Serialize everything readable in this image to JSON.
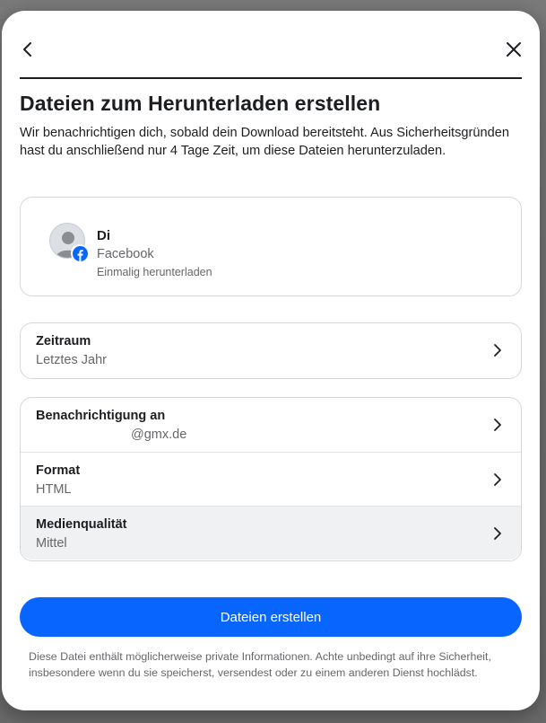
{
  "dialog": {
    "title": "Dateien zum Herunterladen erstellen",
    "description": "Wir benachrichtigen dich, sobald dein Download bereitsteht. Aus Sicherheitsgründen hast du anschließend nur 4 Tage Zeit, um diese Dateien herunterzuladen."
  },
  "account": {
    "name": "Di",
    "platform": "Facebook",
    "note": "Einmalig herunterladen",
    "avatar_icon": "user-silhouette-icon",
    "badge_icon": "facebook-icon"
  },
  "range": {
    "label": "Zeitraum",
    "value": "Letztes Jahr"
  },
  "settings": [
    {
      "label": "Benachrichtigung an",
      "value": "@gmx.de"
    },
    {
      "label": "Format",
      "value": "HTML"
    },
    {
      "label": "Medienqualität",
      "value": "Mittel"
    }
  ],
  "actions": {
    "create_label": "Dateien erstellen"
  },
  "footnote": "Diese Datei enthält möglicherweise private Informationen. Achte unbedingt auf ihre Sicherheit, insbesondere wenn du sie speicherst, versendest oder zu einem anderen Dienst hochlädst.",
  "colors": {
    "primary": "#0866ff",
    "text": "#1c1e21",
    "secondary_text": "#65676b",
    "border": "#d5d7db"
  }
}
